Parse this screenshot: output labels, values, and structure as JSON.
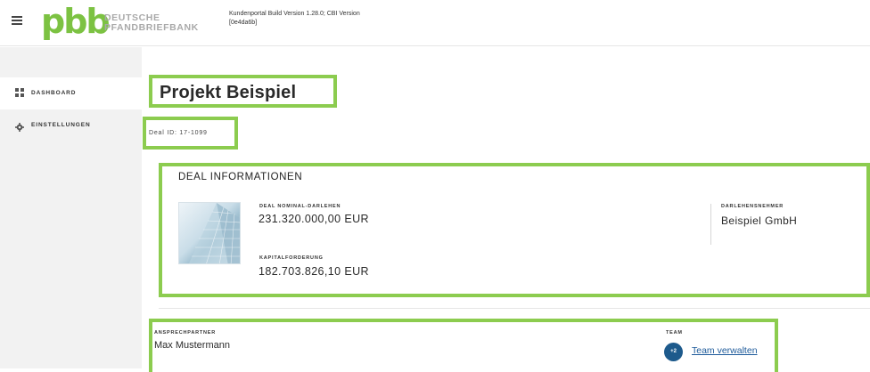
{
  "header": {
    "logo_mark": "pbb",
    "logo_line1": "DEUTSCHE",
    "logo_line2": "PFANDBRIEFBANK",
    "build_line1": "Kundenportal Build Version 1.28.0; CBI Version",
    "build_line2": "[0e4da6b]"
  },
  "sidebar": {
    "items": [
      {
        "label": "DASHBOARD",
        "icon": "dashboard-icon"
      },
      {
        "label": "EINSTELLUNGEN",
        "icon": "gear-icon"
      }
    ]
  },
  "project": {
    "title": "Projekt Beispiel",
    "deal_id": "Deal ID: 17-1099"
  },
  "deal_info": {
    "section_title": "DEAL INFORMATIONEN",
    "nominal_label": "DEAL NOMINAL-DARLEHEN",
    "nominal_value": "231.320.000,00 EUR",
    "capital_label": "KAPITALFORDERUNG",
    "capital_value": "182.703.826,10 EUR",
    "borrower_label": "DARLEHENSNEHMER",
    "borrower_value": "Beispiel GmbH"
  },
  "contact": {
    "label": "ANSPRECHPARTNER",
    "name": "Max Mustermann",
    "team_label": "TEAM",
    "team_badge": "+2",
    "team_link": "Team verwalten"
  },
  "colors": {
    "brand_green": "#7cc242",
    "highlight_green": "#8ccc4f",
    "link_blue": "#1d5a9a",
    "badge_blue": "#1d5a8c"
  }
}
